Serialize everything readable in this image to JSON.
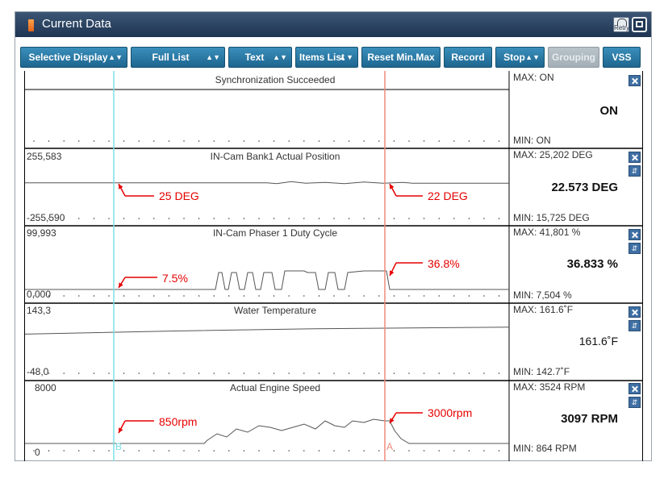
{
  "window": {
    "title": "Current Data",
    "retry_label": "Retry"
  },
  "toolbar": {
    "buttons": [
      {
        "label": "Selective Display",
        "spinner": true
      },
      {
        "label": "Full List",
        "spinner": true
      },
      {
        "label": "Text",
        "spinner": true
      },
      {
        "label": "Items List",
        "spinner": true
      },
      {
        "label": "Reset Min.Max",
        "spinner": false
      },
      {
        "label": "Record",
        "spinner": false
      },
      {
        "label": "Stop",
        "spinner": true
      },
      {
        "label": "Grouping",
        "spinner": false,
        "disabled": true
      },
      {
        "label": "VSS",
        "spinner": false
      }
    ]
  },
  "cursors": {
    "b_label": "B",
    "a_label": "A",
    "b_color": "#7ee0e6",
    "a_color": "#f08a7a"
  },
  "panels": [
    {
      "title": "Synchronization Succeeded",
      "scale_max": "",
      "scale_min": "",
      "max_label": "MAX: ON",
      "min_label": "MIN: ON",
      "current": "ON",
      "has_order": false,
      "series": [
        [
          0,
          0.7
        ],
        [
          1,
          0.7
        ]
      ]
    },
    {
      "title": "IN-Cam Bank1 Actual Position",
      "scale_max": "255,583",
      "scale_min": "-255,590",
      "max_label": "MAX: 25,202 DEG",
      "min_label": "MIN: 15,725 DEG",
      "current": "22.573 DEG",
      "has_order": true,
      "series": [
        [
          0,
          0.445
        ],
        [
          0.5,
          0.445
        ],
        [
          0.52,
          0.455
        ],
        [
          0.55,
          0.43
        ],
        [
          0.58,
          0.45
        ],
        [
          0.62,
          0.44
        ],
        [
          0.66,
          0.455
        ],
        [
          0.7,
          0.435
        ],
        [
          0.74,
          0.45
        ],
        [
          0.78,
          0.44
        ],
        [
          0.8,
          0.45
        ],
        [
          1,
          0.45
        ]
      ]
    },
    {
      "title": "IN-Cam Phaser 1 Duty Cycle",
      "scale_max": "99,993",
      "scale_min": "0,000",
      "max_label": "MAX: 41,801 %",
      "min_label": "MIN: 7,504 %",
      "current": "36.833 %",
      "has_order": true,
      "series": []
    },
    {
      "title": "Water Temperature",
      "scale_max": "143,3",
      "scale_min": "-48,0",
      "max_label": "MAX:  161.6˚F",
      "min_label": "MIN:   142.7˚F",
      "current": "161.6˚F",
      "has_order": true,
      "series": [
        [
          0,
          0.4
        ],
        [
          0.3,
          0.36
        ],
        [
          0.6,
          0.33
        ],
        [
          1,
          0.31
        ]
      ]
    },
    {
      "title": "Actual Engine Speed",
      "scale_max": "8000",
      "scale_min": "0",
      "max_label": "MAX:   3524 RPM",
      "min_label": "MIN:    864 RPM",
      "current": "3097 RPM",
      "has_order": true,
      "series": []
    }
  ],
  "annotations": [
    {
      "text": "25 DEG"
    },
    {
      "text": "22 DEG"
    },
    {
      "text": "7.5%"
    },
    {
      "text": "36.8%"
    },
    {
      "text": "850rpm"
    },
    {
      "text": "3000rpm"
    }
  ]
}
